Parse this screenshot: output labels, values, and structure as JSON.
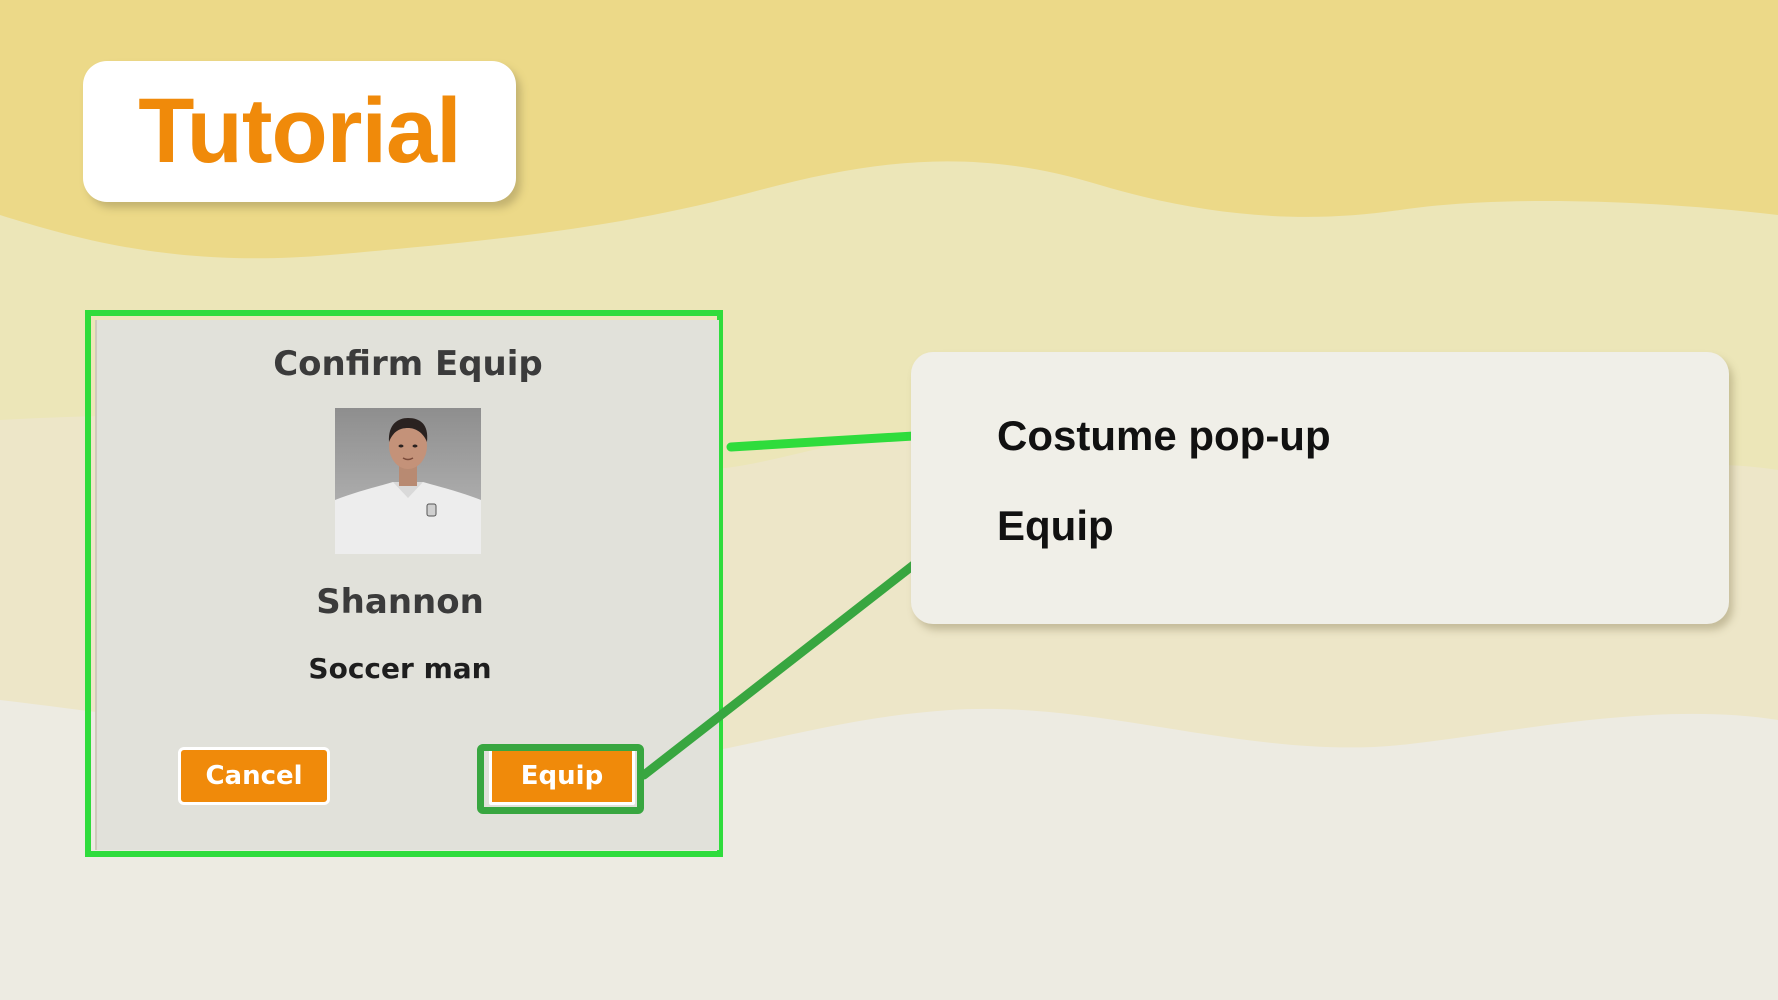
{
  "header": {
    "title": "Tutorial"
  },
  "popup": {
    "title": "Confirm Equip",
    "avatar_icon": "character-portrait",
    "character_name": "Shannon",
    "character_description": "Soccer man",
    "cancel_label": "Cancel",
    "equip_label": "Equip"
  },
  "callouts": {
    "item_1": "Costume pop-up",
    "item_2": "Equip"
  },
  "colors": {
    "accent_orange": "#f08a0a",
    "highlight_green": "#2fdc3c",
    "connector_green": "#38a640",
    "background_yellow": "#ecd988"
  }
}
